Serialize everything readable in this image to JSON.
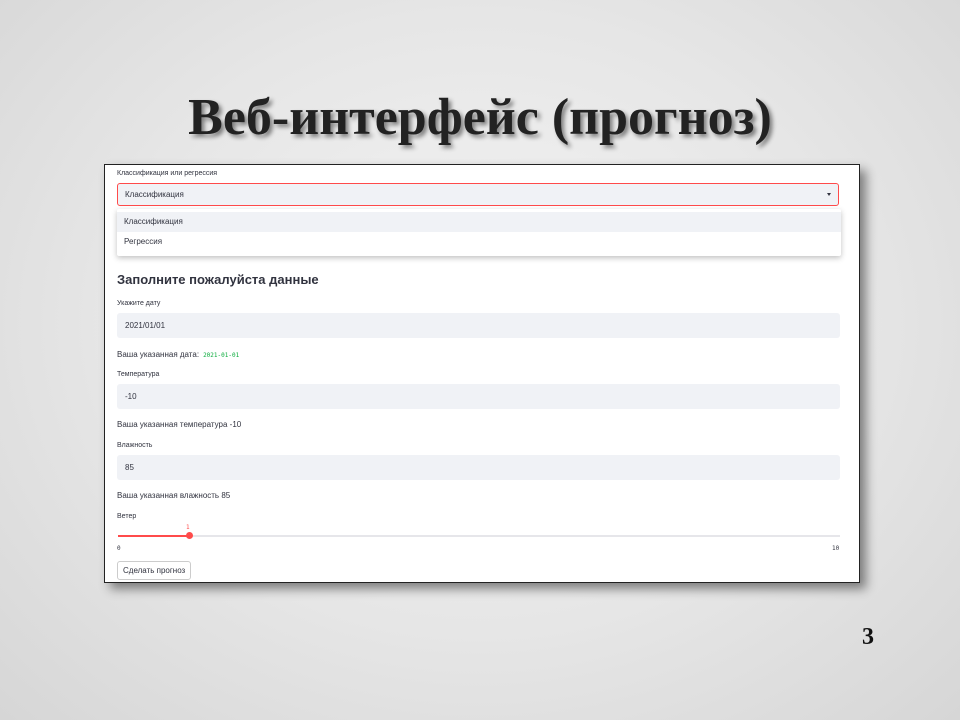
{
  "slide": {
    "title": "Веб-интерфейс (прогноз)",
    "page_number": "3"
  },
  "app": {
    "mode_select": {
      "label": "Классификация или регрессия",
      "value": "Классификация",
      "options": [
        "Классификация",
        "Регрессия"
      ]
    },
    "form_heading": "Заполните пожалуйста данные",
    "date": {
      "label": "Укажите дату",
      "value": "2021/01/01",
      "echo_text": "Ваша указанная дата:",
      "echo_value": "2021-01-01"
    },
    "temperature": {
      "label": "Температура",
      "value": "-10",
      "echo_text": "Ваша указанная температура -10"
    },
    "humidity": {
      "label": "Влажность",
      "value": "85",
      "echo_text": "Ваша указанная влажность 85"
    },
    "wind": {
      "label": "Ветер",
      "value": "1",
      "min": "0",
      "max": "10"
    },
    "predict_button": "Сделать прогноз"
  },
  "colors": {
    "accent": "#ff4b4b",
    "input_bg": "#f0f2f6",
    "code_green": "#09ab3b",
    "text": "#31333f"
  }
}
